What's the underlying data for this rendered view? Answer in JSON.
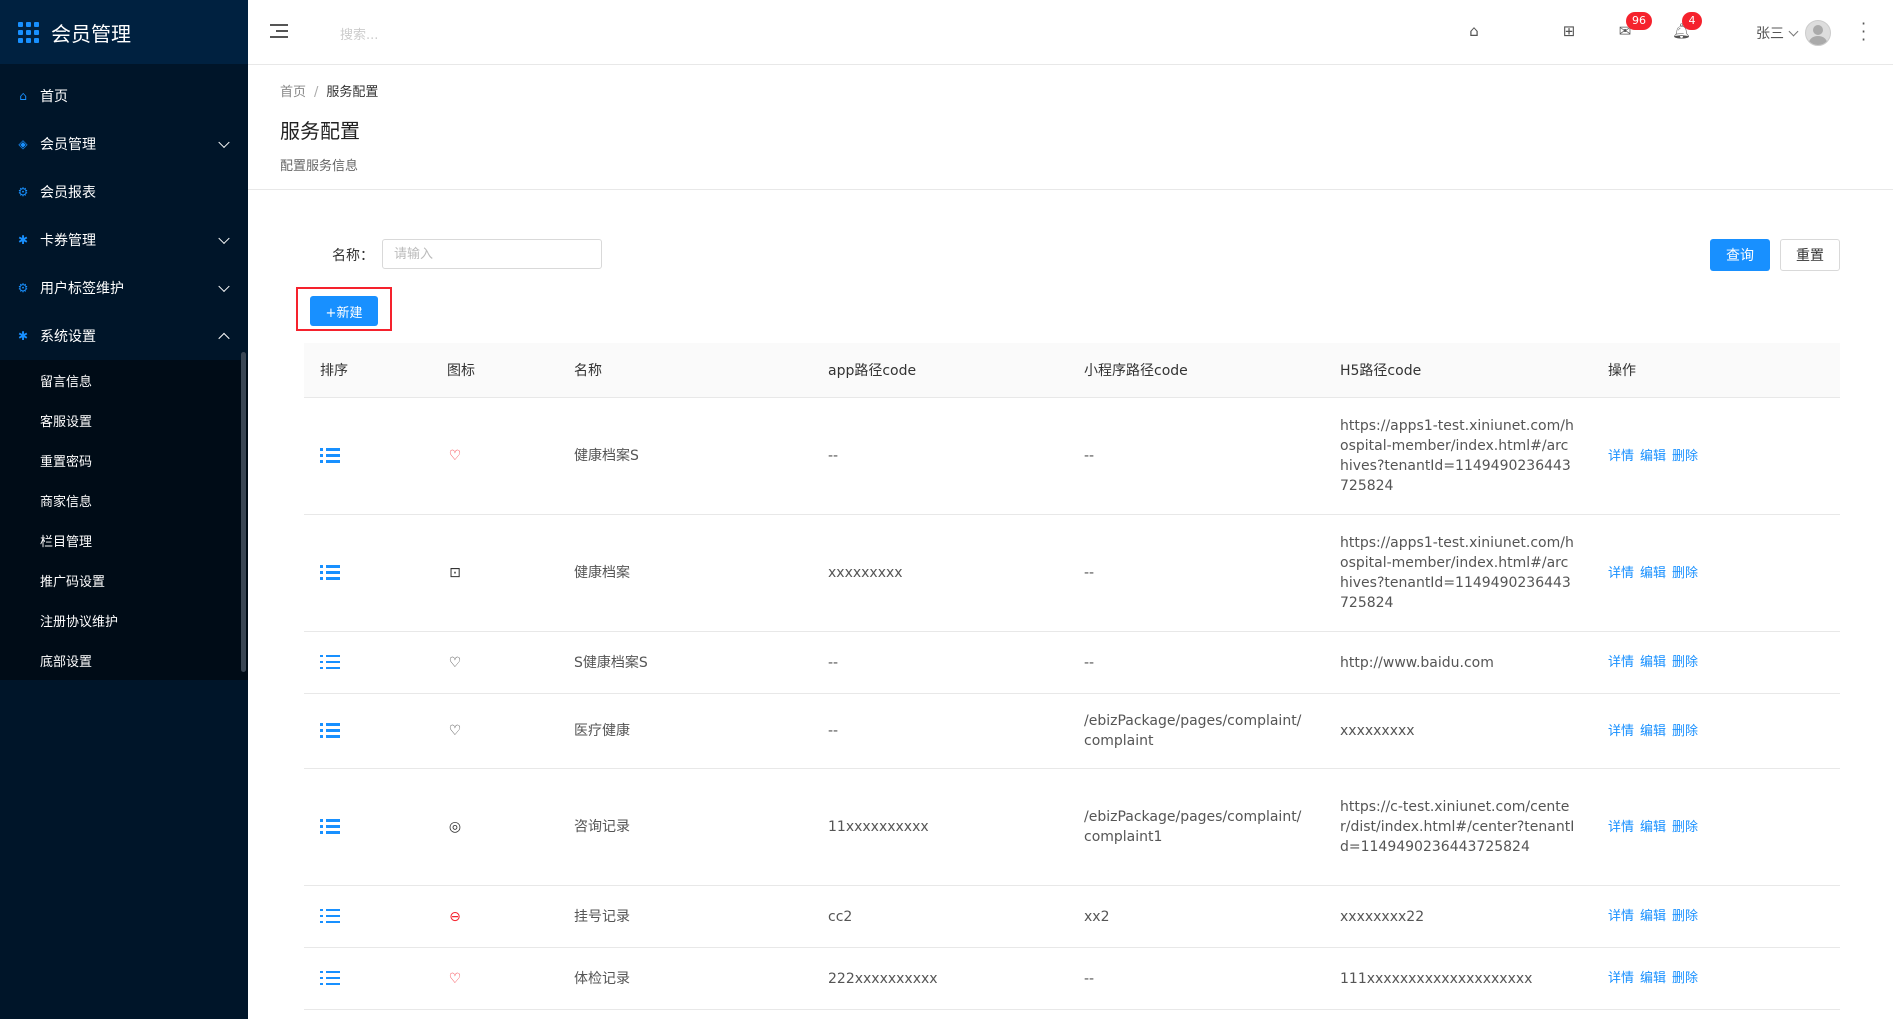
{
  "app": {
    "title": "会员管理"
  },
  "sidebar": {
    "items": [
      {
        "label": "首页",
        "icon": "home-icon"
      },
      {
        "label": "会员管理",
        "icon": "member-icon",
        "expandable": true
      },
      {
        "label": "会员报表",
        "icon": "report-icon"
      },
      {
        "label": "卡券管理",
        "icon": "coupon-icon",
        "expandable": true
      },
      {
        "label": "用户标签维护",
        "icon": "tag-icon",
        "expandable": true
      },
      {
        "label": "系统设置",
        "icon": "settings-icon",
        "expandable": true,
        "expanded": true
      }
    ],
    "sub_items": [
      "留言信息",
      "客服设置",
      "重置密码",
      "商家信息",
      "栏目管理",
      "推广码设置",
      "注册协议维护",
      "底部设置"
    ]
  },
  "header": {
    "search_placeholder": "搜索...",
    "mail_count": "96",
    "bell_count": "4",
    "user_name": "张三"
  },
  "page": {
    "breadcrumb_home": "首页",
    "breadcrumb_sep": "/",
    "breadcrumb_current": "服务配置",
    "title": "服务配置",
    "description": "配置服务信息"
  },
  "filter": {
    "name_label": "名称：",
    "name_placeholder": "请输入",
    "query_label": "查询",
    "reset_label": "重置",
    "new_label": "+新建"
  },
  "table": {
    "columns": [
      "排序",
      "图标",
      "名称",
      "app路径code",
      "小程序路径code",
      "H5路径code",
      "操作"
    ],
    "actions": [
      "详情",
      "编辑",
      "删除"
    ],
    "rows": [
      {
        "icon": "heart-icon",
        "icon_color": "#f5222d",
        "name": "健康档案S",
        "app": "--",
        "mini": "--",
        "h5": "https://apps1-test.xiniunet.com/hospital-member/index.html#/archives?tenantId=1149490236443725824"
      },
      {
        "icon": "gift-icon",
        "icon_color": "#333333",
        "name": "健康档案",
        "app": "xxxxxxxxx",
        "mini": "--",
        "h5": "https://apps1-test.xiniunet.com/hospital-member/index.html#/archives?tenantId=1149490236443725824"
      },
      {
        "icon": "heart-outline-icon",
        "icon_color": "#333333",
        "name": "S健康档案S",
        "app": "--",
        "mini": "--",
        "h5": "http://www.baidu.com"
      },
      {
        "icon": "heart-outline-icon",
        "icon_color": "#333333",
        "name": "医疗健康",
        "app": "--",
        "mini": "/ebizPackage/pages/complaint/complaint",
        "h5": "xxxxxxxxx"
      },
      {
        "icon": "location-icon",
        "icon_color": "#333333",
        "name": "咨询记录",
        "app": "11xxxxxxxxxx",
        "mini": "/ebizPackage/pages/complaint/complaint1",
        "h5": "https://c-test.xiniunet.com/center/dist/index.html#/center?tenantId=1149490236443725824"
      },
      {
        "icon": "chat-icon",
        "icon_color": "#f5222d",
        "name": "挂号记录",
        "app": "cc2",
        "mini": "xx2",
        "h5": "xxxxxxxx22"
      },
      {
        "icon": "heart-icon",
        "icon_color": "#f5222d",
        "name": "体检记录",
        "app": "222xxxxxxxxxx",
        "mini": "--",
        "h5": "111xxxxxxxxxxxxxxxxxxxx"
      }
    ]
  }
}
